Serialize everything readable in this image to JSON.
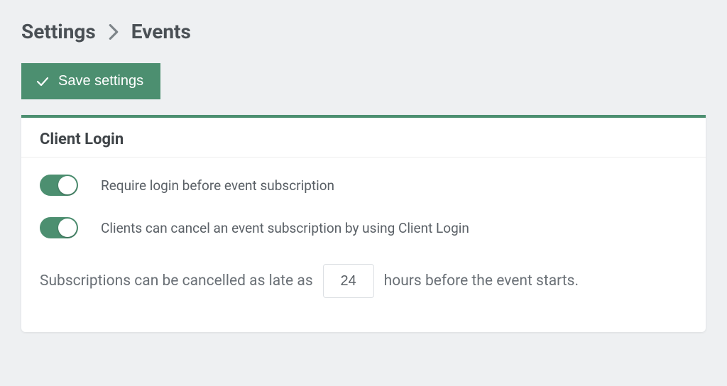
{
  "breadcrumb": {
    "root": "Settings",
    "current": "Events"
  },
  "actions": {
    "save_label": "Save settings"
  },
  "card": {
    "title": "Client Login",
    "toggles": [
      {
        "label": "Require login before event subscription",
        "on": true
      },
      {
        "label": "Clients can cancel an event subscription by using Client Login",
        "on": true
      }
    ],
    "cancel_sentence": {
      "before": "Subscriptions can be cancelled as late as",
      "value": "24",
      "after": "hours before the event starts."
    }
  },
  "colors": {
    "accent": "#4c8f70",
    "page_bg": "#eef0f2",
    "text_primary": "#4a5055",
    "text_secondary": "#6a7076"
  }
}
